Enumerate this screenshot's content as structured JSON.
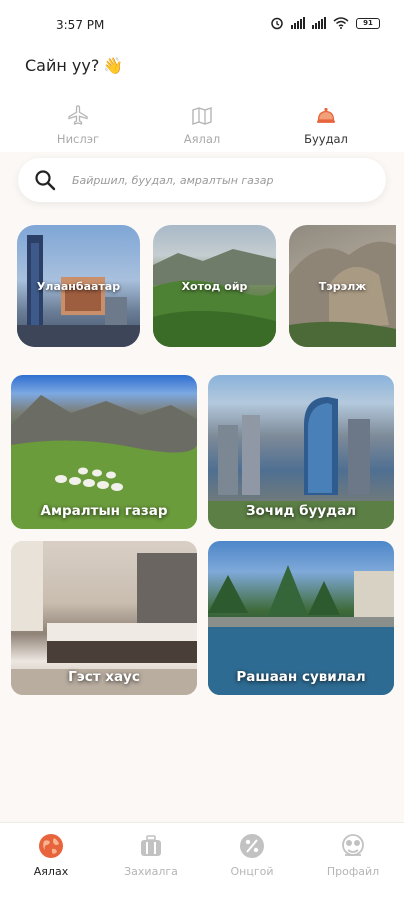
{
  "status_bar": {
    "time": "3:57 PM",
    "battery": "91"
  },
  "greeting": {
    "text": "Сайн уу?",
    "emoji": "👋"
  },
  "tabs": [
    {
      "label": "Нислэг",
      "icon": "plane-icon",
      "active": false
    },
    {
      "label": "Аялал",
      "icon": "map-icon",
      "active": false
    },
    {
      "label": "Буудал",
      "icon": "bell-icon",
      "active": true
    }
  ],
  "search": {
    "placeholder": "Байршил, буудал, амралтын газар",
    "value": ""
  },
  "cities": [
    {
      "label": "Улаанбаатар"
    },
    {
      "label": "Хотод ойр"
    },
    {
      "label": "Тэрэлж"
    }
  ],
  "categories": [
    {
      "label": "Амралтын газар"
    },
    {
      "label": "Зочид буудал"
    },
    {
      "label": "Гэст хаус"
    },
    {
      "label": "Рашаан сувилал"
    }
  ],
  "bottom_nav": [
    {
      "label": "Аялах",
      "icon": "globe-icon",
      "active": true
    },
    {
      "label": "Захиалга",
      "icon": "briefcase-icon",
      "active": false
    },
    {
      "label": "Онцгой",
      "icon": "percent-icon",
      "active": false
    },
    {
      "label": "Профайл",
      "icon": "profile-icon",
      "active": false
    }
  ],
  "colors": {
    "accent": "#e8643c",
    "background": "#fbf8f5"
  }
}
